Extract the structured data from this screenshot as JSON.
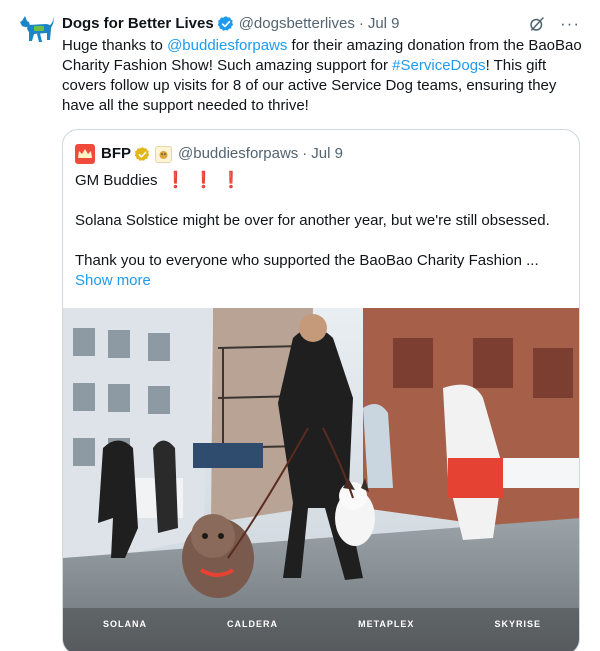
{
  "tweet": {
    "author_name": "Dogs for Better Lives",
    "handle": "@dogsbetterlives",
    "separator": "·",
    "date": "Jul 9",
    "more": "···",
    "text": {
      "part1": "Huge thanks to ",
      "mention": "@buddiesforpaws",
      "part2": " for their amazing donation from the BaoBao Charity Fashion Show! Such amazing support for ",
      "hashtag": "#ServiceDogs",
      "part3": "! This gift covers follow up visits for 8 of our active Service Dog teams, ensuring they have all the support needed to thrive!"
    }
  },
  "quote": {
    "name": "BFP",
    "handle": "@buddiesforpaws",
    "separator": "·",
    "date": "Jul 9",
    "line1": "GM Buddies",
    "bangs": [
      "❗",
      "❗",
      "❗"
    ],
    "para2": "Solana Solstice might be over for another year, but we're still obsessed.",
    "para3": "Thank you to everyone who supported the BaoBao Charity Fashion ...",
    "show_more": "Show more",
    "banner_logos": [
      "SOLANA",
      "CALDERA",
      "METAPLEX",
      "SKYRISE"
    ]
  },
  "colors": {
    "link": "#1d9bf0",
    "verified_blue": "#1d9bf0",
    "verified_gold": "#e2b719",
    "muted": "#536471",
    "border": "#cfd9de"
  }
}
